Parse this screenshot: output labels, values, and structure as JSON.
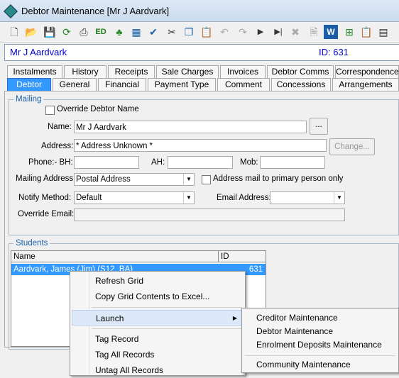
{
  "window": {
    "title": "Debtor Maintenance  [Mr J Aardvark]"
  },
  "header": {
    "debtor_name": "Mr J Aardvark",
    "id_text": "ID: 631"
  },
  "toolbar": {
    "icons": [
      "new-icon",
      "open-icon",
      "save-icon",
      "refresh-icon",
      "print-icon",
      "edit-icon",
      "tree-icon",
      "spellcheck-icon",
      "cut-icon",
      "copy-icon",
      "paste-icon",
      "undo-icon",
      "redo-icon",
      "play-icon",
      "skip-icon",
      "delete-icon",
      "word-icon",
      "grid-icon",
      "clipboard-icon",
      "calendar-icon"
    ]
  },
  "tabs_back": [
    "Instalments",
    "History",
    "Receipts",
    "Sale Charges",
    "Invoices",
    "Debtor Comms",
    "Correspondence"
  ],
  "tabs_front": [
    "Debtor",
    "General",
    "Financial",
    "Payment Type",
    "Comment",
    "Concessions",
    "Arrangements"
  ],
  "mailing": {
    "legend": "Mailing",
    "override_label": "Override Debtor Name",
    "name_label": "Name:",
    "name_value": "Mr J Aardvark",
    "ellipsis": "...",
    "address_label": "Address:",
    "address_value": "* Address Unknown *",
    "change_button": "Change...",
    "phone_label": "Phone:- BH:",
    "ah_label": "AH:",
    "mob_label": "Mob:",
    "mailing_address_label": "Mailing Address:",
    "mailing_address_value": "Postal Address",
    "primary_label": "Address mail to primary person only",
    "notify_label": "Notify Method:",
    "notify_value": "Default",
    "email_label": "Email Address:",
    "override_email_label": "Override Email:"
  },
  "students": {
    "legend": "Students",
    "columns": [
      "Name",
      "ID"
    ],
    "row": {
      "name": "Aardvark, James (Jim) (S12, BA)",
      "id": "631"
    }
  },
  "context_menu": {
    "items": [
      "Refresh Grid",
      "Copy Grid Contents to Excel...",
      "Launch",
      "Tag Record",
      "Tag All Records",
      "Untag All Records"
    ],
    "submenu_arrow": "▶"
  },
  "submenu": {
    "items": [
      "Creditor Maintenance",
      "Debtor Maintenance",
      "Enrolment Deposits Maintenance",
      "Community Maintenance"
    ]
  }
}
